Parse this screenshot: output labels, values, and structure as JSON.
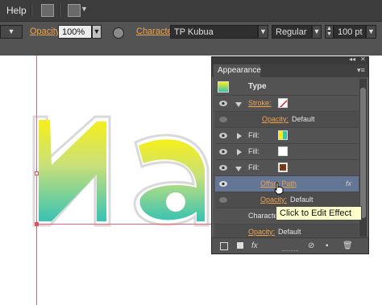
{
  "menubar": {
    "help_label": "Help"
  },
  "controlbar": {
    "opacity_label": "Opacity:",
    "opacity_value": "100%",
    "character_label": "Character:",
    "font_family": "TP Kubua",
    "font_style": "Regular",
    "font_size": "100 pt"
  },
  "panel": {
    "tab_label": "Appearance",
    "type_label": "Type",
    "rows": [
      {
        "label": "Stroke:",
        "kind": "stroke"
      },
      {
        "label": "Opacity:",
        "value": "Default"
      },
      {
        "label": "Fill:"
      },
      {
        "label": "Fill:"
      },
      {
        "label": "Fill:"
      },
      {
        "label": "Offset Path",
        "fx": "fx"
      },
      {
        "label": "Opacity:",
        "value": "Default"
      },
      {
        "label": "Characters"
      },
      {
        "label": "Opacity:",
        "value": "Default"
      }
    ],
    "footer_fx": "fx"
  },
  "tooltip": {
    "text": "Click to Edit Effect"
  },
  "colors": {
    "accent_orange": "#f0a24b",
    "highlight_row": "#637696",
    "gradient_top": "#f7ef1a",
    "gradient_bottom": "#37c3b3"
  }
}
